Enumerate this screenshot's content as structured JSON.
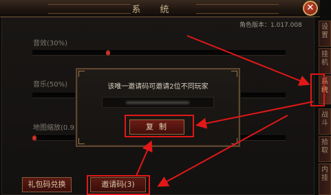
{
  "window": {
    "title": "系统",
    "close_glyph": "✕"
  },
  "version_label": "角色版本：1.017.008",
  "settings": {
    "sound_effect": {
      "label": "音效(30%)",
      "level": 0.3
    },
    "music": {
      "label": "音乐(50%)",
      "level": 0.5
    },
    "map_zoom": {
      "label": "地图缩放(0.95",
      "level": 0.0
    }
  },
  "side_tabs": [
    {
      "label": "设置",
      "active": false
    },
    {
      "label": "挂机",
      "active": false
    },
    {
      "label": "系统",
      "active": true
    },
    {
      "label": "战斗",
      "active": false
    },
    {
      "label": "拾取",
      "active": false
    },
    {
      "label": "内挂",
      "active": false
    }
  ],
  "buttons": {
    "gift_code": "礼包码兑换",
    "invite_code": "邀请码(3)"
  },
  "popup": {
    "message": "该唯一邀请码可邀请2位不同玩家",
    "copy_label": "复制"
  },
  "colors": {
    "highlight": "#e21818",
    "accent": "#d6a860",
    "slider_knob": "#e04030"
  }
}
